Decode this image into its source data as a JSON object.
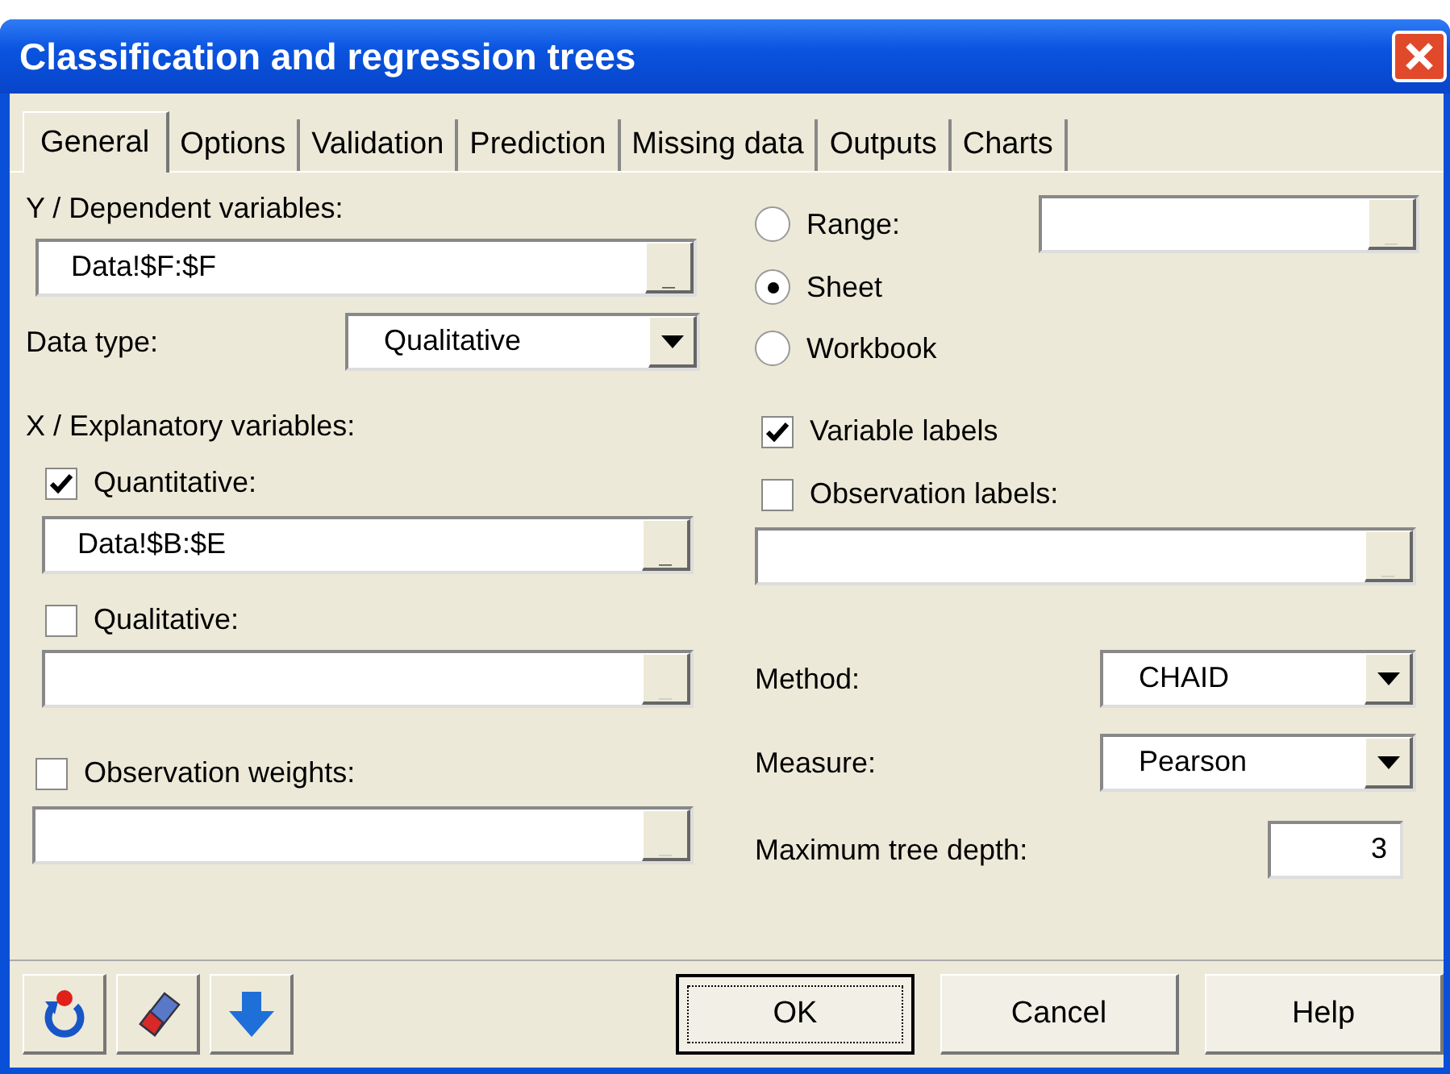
{
  "window": {
    "title": "Classification and regression trees"
  },
  "tabs": [
    {
      "label": "General",
      "selected": true
    },
    {
      "label": "Options",
      "selected": false
    },
    {
      "label": "Validation",
      "selected": false
    },
    {
      "label": "Prediction",
      "selected": false
    },
    {
      "label": "Missing data",
      "selected": false
    },
    {
      "label": "Outputs",
      "selected": false
    },
    {
      "label": "Charts",
      "selected": false
    }
  ],
  "dependent": {
    "label": "Y / Dependent variables:",
    "value": "Data!$F:$F",
    "picker": "_"
  },
  "data_type": {
    "label": "Data type:",
    "value": "Qualitative"
  },
  "explanatory": {
    "label": "X / Explanatory variables:"
  },
  "quantitative": {
    "label": "Quantitative:",
    "checked": true,
    "value": "Data!$B:$E",
    "picker": "_"
  },
  "qualitative": {
    "label": "Qualitative:",
    "checked": false,
    "picker": "_"
  },
  "observation_weights": {
    "label": "Observation weights:",
    "checked": false,
    "picker": "_"
  },
  "scope": [
    {
      "label": "Range:",
      "selected": false
    },
    {
      "label": "Sheet",
      "selected": true
    },
    {
      "label": "Workbook",
      "selected": false
    }
  ],
  "range_field": {
    "picker": "_"
  },
  "variable_labels": {
    "label": "Variable labels",
    "checked": true
  },
  "observation_labels": {
    "label": "Observation labels:",
    "checked": false,
    "picker": "_"
  },
  "method": {
    "label": "Method:",
    "value": "CHAID"
  },
  "measure": {
    "label": "Measure:",
    "value": "Pearson"
  },
  "max_depth": {
    "label": "Maximum tree depth:",
    "value": "3"
  },
  "buttons": [
    {
      "label": "OK",
      "focused": true
    },
    {
      "label": "Cancel",
      "focused": false
    },
    {
      "label": "Help",
      "focused": false
    }
  ]
}
